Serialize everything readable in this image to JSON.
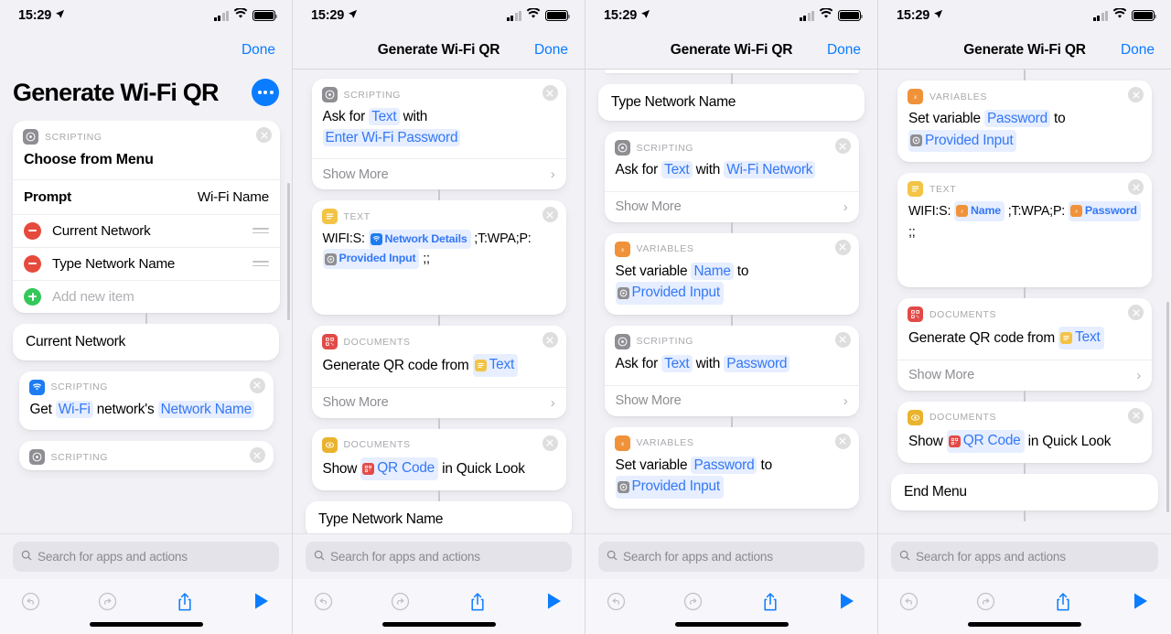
{
  "status_bar": {
    "time": "15:29",
    "location_arrow": "location-arrow",
    "wifi": "wifi-icon",
    "battery": "battery-icon"
  },
  "nav": {
    "done_label": "Done",
    "title": "Generate Wi-Fi QR"
  },
  "panel1": {
    "large_title": "Generate Wi-Fi QR",
    "more_button": "more-options",
    "choose_menu_card": {
      "category": "SCRIPTING",
      "title": "Choose from Menu",
      "prompt_key": "Prompt",
      "prompt_value": "Wi-Fi Name",
      "items": [
        "Current Network",
        "Type Network Name"
      ],
      "add_new": "Add new item"
    },
    "branch_label": "Current Network",
    "get_wifi_card": {
      "category": "SCRIPTING",
      "t1": "Get",
      "v1": "Wi-Fi",
      "t2": "network's",
      "v2": "Network Name"
    },
    "partial_card_category": "SCRIPTING"
  },
  "panel2": {
    "ask_password_card": {
      "category": "SCRIPTING",
      "t1": "Ask for",
      "v1": "Text",
      "t2": "with",
      "v2": "Enter Wi-Fi Password",
      "show_more": "Show More"
    },
    "text_card": {
      "category": "TEXT",
      "seg1": "WIFI:S:",
      "var1": "Network Details",
      "seg2": ";T:WPA;P:",
      "var2": "Provided Input",
      "seg3": ";;"
    },
    "qr_card": {
      "category": "DOCUMENTS",
      "t1": "Generate QR code from",
      "v1": "Text",
      "show_more": "Show More"
    },
    "show_qr_card": {
      "category": "DOCUMENTS",
      "t1": "Show",
      "v1": "QR Code",
      "t2": "in Quick Look"
    },
    "branch_label": "Type Network Name"
  },
  "panel3": {
    "branch_label": "Type Network Name",
    "ask_network_card": {
      "category": "SCRIPTING",
      "t1": "Ask for",
      "v1": "Text",
      "t2": "with",
      "v2": "Wi-Fi Network",
      "show_more": "Show More"
    },
    "set_name_card": {
      "category": "VARIABLES",
      "t1": "Set variable",
      "v1": "Name",
      "t2": "to",
      "v2": "Provided Input"
    },
    "ask_password_card": {
      "category": "SCRIPTING",
      "t1": "Ask for",
      "v1": "Text",
      "t2": "with",
      "v2": "Password",
      "show_more": "Show More"
    },
    "set_password_card": {
      "category": "VARIABLES",
      "t1": "Set variable",
      "v1": "Password",
      "t2": "to",
      "v2": "Provided Input"
    }
  },
  "panel4": {
    "set_password_card": {
      "category": "VARIABLES",
      "t1": "Set variable",
      "v1": "Password",
      "t2": "to",
      "v2": "Provided Input"
    },
    "text_card": {
      "category": "TEXT",
      "seg1": "WIFI:S:",
      "var1": "Name",
      "seg2": ";T:WPA;P:",
      "var2": "Password",
      "seg3": ";;"
    },
    "qr_card": {
      "category": "DOCUMENTS",
      "t1": "Generate QR code from",
      "v1": "Text",
      "show_more": "Show More"
    },
    "show_qr_card": {
      "category": "DOCUMENTS",
      "t1": "Show",
      "v1": "QR Code",
      "t2": "in Quick Look"
    },
    "end_menu": "End Menu"
  },
  "bottom": {
    "search_placeholder": "Search for apps and actions",
    "search_icon": "search-icon",
    "undo": "undo-icon",
    "redo": "redo-icon",
    "share": "share-icon",
    "play": "play-icon"
  },
  "colors": {
    "accent_blue": "#0a7cff",
    "token_blue": "#3478f6",
    "token_bg": "#e6eeff",
    "scripting_gray": "#8e8e93",
    "text_yellow": "#f3c344",
    "variables_orange": "#f0923a",
    "documents_red": "#e24a47",
    "documents_yellow": "#eab32e",
    "wifi_blue": "#1d7cf2",
    "minus_red": "#e64a3c",
    "plus_green": "#34c759",
    "page_bg": "#f2f1f6"
  }
}
